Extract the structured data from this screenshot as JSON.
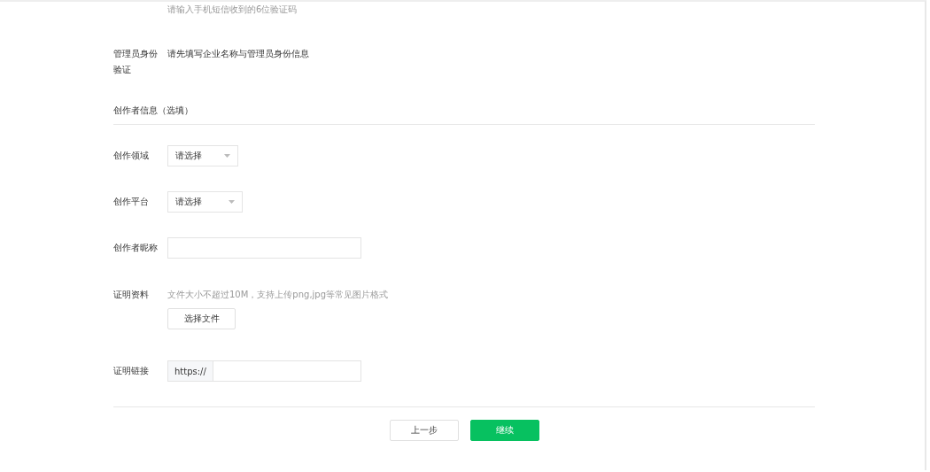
{
  "top_hint": "请输入手机短信收到的6位验证码",
  "admin": {
    "label": "管理员身份验证",
    "value": "请先填写企业名称与管理员身份信息"
  },
  "section": {
    "title": "创作者信息（选填）"
  },
  "fields": [
    {
      "kind": "select",
      "label": "创作领域",
      "value": "请选择"
    },
    {
      "kind": "select",
      "label": "创作平台",
      "value": "请选择"
    },
    {
      "kind": "input",
      "label": "创作者昵称"
    },
    {
      "kind": "upload",
      "label": "证明资料",
      "hint": "文件大小不超过10M，支持上传png,jpg等常见图片格式",
      "button": "选择文件"
    },
    {
      "kind": "prefix_input",
      "label": "证明链接",
      "prefix": "https://"
    }
  ],
  "buttons": [
    {
      "label": "上一步",
      "primary": false
    },
    {
      "label": "继续",
      "primary": true
    }
  ]
}
